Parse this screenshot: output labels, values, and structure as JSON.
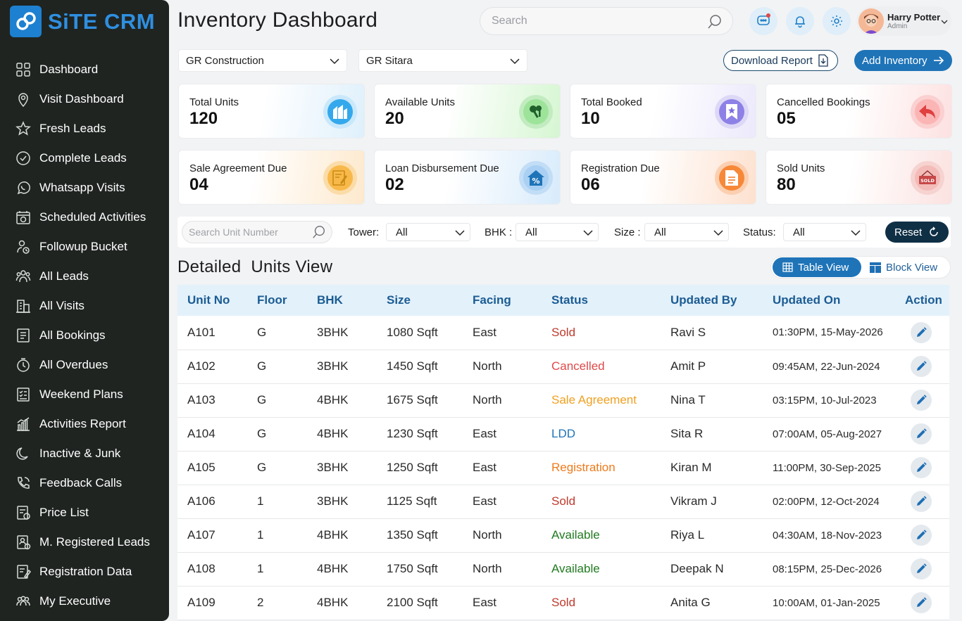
{
  "brand": {
    "name": "SiTE CRM"
  },
  "sidebar": {
    "items": [
      {
        "label": "Dashboard",
        "icon": "dashboard-icon"
      },
      {
        "label": "Visit Dashboard",
        "icon": "location-pin-icon"
      },
      {
        "label": "Fresh Leads",
        "icon": "star-icon"
      },
      {
        "label": "Complete Leads",
        "icon": "check-circle-icon"
      },
      {
        "label": "Whatsapp Visits",
        "icon": "whatsapp-icon"
      },
      {
        "label": "Scheduled Activities",
        "icon": "calendar-clock-icon"
      },
      {
        "label": "Followup Bucket",
        "icon": "followup-user-icon"
      },
      {
        "label": "All Leads",
        "icon": "users-group-icon"
      },
      {
        "label": "All Visits",
        "icon": "building-visits-icon"
      },
      {
        "label": "All Bookings",
        "icon": "bookings-doc-icon"
      },
      {
        "label": "All Overdues",
        "icon": "overdue-clock-icon"
      },
      {
        "label": "Weekend Plans",
        "icon": "checklist-icon"
      },
      {
        "label": "Activities Report",
        "icon": "bar-chart-icon"
      },
      {
        "label": "Inactive & Junk",
        "icon": "moon-icon"
      },
      {
        "label": "Feedback Calls",
        "icon": "phone-icon"
      },
      {
        "label": "Price List",
        "icon": "price-list-icon"
      },
      {
        "label": "M. Registered Leads",
        "icon": "registered-doc-icon"
      },
      {
        "label": "Registration Data",
        "icon": "edit-doc-icon"
      },
      {
        "label": "My Executive",
        "icon": "team-icon"
      }
    ]
  },
  "header": {
    "title": "Inventory Dashboard",
    "search_placeholder": "Search",
    "user": {
      "name": "Harry Potter",
      "role": "Admin"
    }
  },
  "filters": {
    "company": "GR Construction",
    "project": "GR Sitara",
    "download_label": "Download Report",
    "add_label": "Add Inventory"
  },
  "stats": [
    {
      "label": "Total Units",
      "value": "120",
      "icon": "building-icon",
      "color": "#2da0e8"
    },
    {
      "label": "Available Units",
      "value": "20",
      "icon": "keys-icon",
      "color": "#3a9a4a"
    },
    {
      "label": "Total Booked",
      "value": "10",
      "icon": "bookmark-star-icon",
      "color": "#7a6ee0"
    },
    {
      "label": "Cancelled Bookings",
      "value": "05",
      "icon": "undo-arrow-icon",
      "color": "#e45252"
    },
    {
      "label": "Sale Agreement Due",
      "value": "04",
      "icon": "agreement-doc-icon",
      "color": "#f0a020"
    },
    {
      "label": "Loan Disbursement Due",
      "value": "02",
      "icon": "home-percent-icon",
      "color": "#2280d0"
    },
    {
      "label": "Registration Due",
      "value": "06",
      "icon": "registration-doc-icon",
      "color": "#f27a25"
    },
    {
      "label": "Sold Units",
      "value": "80",
      "icon": "sold-sign-icon",
      "color": "#c84848"
    }
  ],
  "unit_filters": {
    "search_placeholder": "Search Unit Number",
    "tower_label": "Tower:",
    "tower_value": "All",
    "bhk_label": "BHK :",
    "bhk_value": "All",
    "size_label": "Size :",
    "size_value": "All",
    "status_label": "Status:",
    "status_value": "All",
    "reset_label": "Reset"
  },
  "section": {
    "title": "Detailed  Units View",
    "table_view": "Table View",
    "block_view": "Block View"
  },
  "table": {
    "columns": [
      "Unit No",
      "Floor",
      "BHK",
      "Size",
      "Facing",
      "Status",
      "Updated By",
      "Updated On",
      "Action"
    ],
    "rows": [
      {
        "unit": "A101",
        "floor": "G",
        "bhk": "3BHK",
        "size": "1080 Sqft",
        "facing": "East",
        "status": "Sold",
        "by": "Ravi S",
        "on": "01:30PM, 15-May-2026"
      },
      {
        "unit": "A102",
        "floor": "G",
        "bhk": "3BHK",
        "size": "1450 Sqft",
        "facing": "North",
        "status": "Cancelled",
        "by": "Amit P",
        "on": "09:45AM, 22-Jun-2024"
      },
      {
        "unit": "A103",
        "floor": "G",
        "bhk": "4BHK",
        "size": "1675 Sqft",
        "facing": "North",
        "status": "Sale Agreement",
        "by": "Nina T",
        "on": "03:15PM, 10-Jul-2023"
      },
      {
        "unit": "A104",
        "floor": "G",
        "bhk": "4BHK",
        "size": "1230 Sqft",
        "facing": "East",
        "status": "LDD",
        "by": "Sita R",
        "on": "07:00AM, 05-Aug-2027"
      },
      {
        "unit": "A105",
        "floor": "G",
        "bhk": "3BHK",
        "size": "1250 Sqft",
        "facing": "East",
        "status": "Registration",
        "by": "Kiran M",
        "on": "11:00PM, 30-Sep-2025"
      },
      {
        "unit": "A106",
        "floor": "1",
        "bhk": "3BHK",
        "size": "1125 Sqft",
        "facing": "East",
        "status": "Sold",
        "by": "Vikram J",
        "on": "02:00PM, 12-Oct-2024"
      },
      {
        "unit": "A107",
        "floor": "1",
        "bhk": "4BHK",
        "size": "1350 Sqft",
        "facing": "North",
        "status": "Available",
        "by": "Riya L",
        "on": "04:30AM, 18-Nov-2023"
      },
      {
        "unit": "A108",
        "floor": "1",
        "bhk": "4BHK",
        "size": "1750 Sqft",
        "facing": "North",
        "status": "Available",
        "by": "Deepak N",
        "on": "08:15PM, 25-Dec-2026"
      },
      {
        "unit": "A109",
        "floor": "2",
        "bhk": "4BHK",
        "size": "2100 Sqft",
        "facing": "East",
        "status": "Sold",
        "by": "Anita G",
        "on": "10:00AM, 01-Jan-2025"
      }
    ]
  },
  "status_colors": {
    "Sold": "#c0392b",
    "Cancelled": "#e04848",
    "Sale Agreement": "#f0a020",
    "LDD": "#1f74b8",
    "Registration": "#f07a1a",
    "Available": "#1f7a1f"
  }
}
